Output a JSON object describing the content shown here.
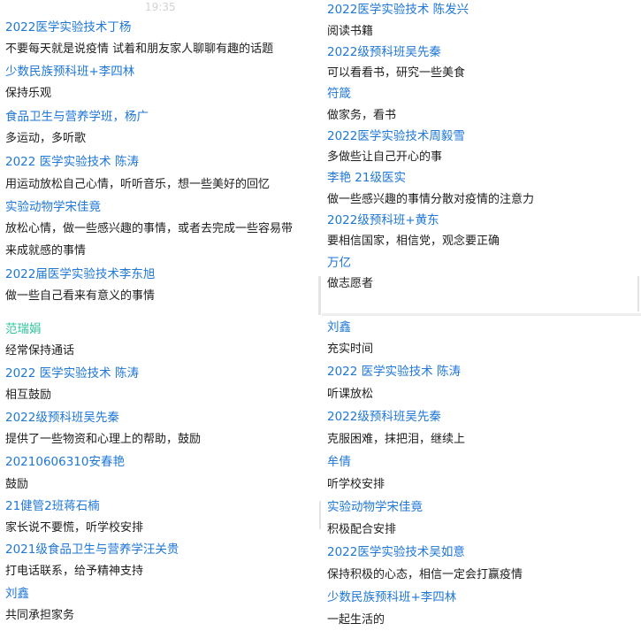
{
  "timestamp": "19:35",
  "panels": [
    {
      "id": "tl",
      "messages": [
        {
          "name": "2022医学实验技术丁杨",
          "text": "不要每天就是说疫情 试着和朋友家人聊聊有趣的话题"
        },
        {
          "name": "少数民族预科班+李四林",
          "text": "保持乐观"
        },
        {
          "name": "食品卫生与营养学班，杨广",
          "text": "多运动，多听歌"
        },
        {
          "name": "2022 医学实验技术  陈涛",
          "text": "用运动放松自己心情，听听音乐，想一些美好的回忆"
        },
        {
          "name": "实验动物学宋佳竟",
          "text": "放松心情，做一些感兴趣的事情，或者去完成一些容易带",
          "text2": "来成就感的事情"
        },
        {
          "name": "2022届医学实验技术李东旭",
          "text": "做一些自己看来有意义的事情"
        }
      ]
    },
    {
      "id": "tr",
      "messages": [
        {
          "name": "2022医学实验技术 陈发兴",
          "text": "阅读书籍"
        },
        {
          "name": "2022级预科班吴先秦",
          "text": "可以看看书，研究一些美食"
        },
        {
          "name": "符箴",
          "text": "做家务，看书"
        },
        {
          "name": "2022医学实验技术周毅雪",
          "text": "多做些让自己开心的事"
        },
        {
          "name": "李艳  21级医实",
          "text": "做一些感兴趣的事情分散对疫情的注意力"
        },
        {
          "name": "2022级预科班+黄东",
          "text": "要相信国家，相信党，观念要正确"
        },
        {
          "name": "万亿",
          "text": "做志愿者"
        }
      ]
    },
    {
      "id": "bl",
      "messages": [
        {
          "name": "范瑞娟",
          "name_color": "green",
          "text": "经常保持通话"
        },
        {
          "name": "2022 医学实验技术  陈涛",
          "text": "相互鼓励"
        },
        {
          "name": "2022级预科班吴先秦",
          "text": "提供了一些物资和心理上的帮助，鼓励"
        },
        {
          "name": "20210606310安春艳",
          "text": "鼓励"
        },
        {
          "name": "21健管2班蒋石楠",
          "text": "家长说不要慌，听学校安排"
        },
        {
          "name": "2021级食品卫生与营养学汪关贵",
          "text": "打电话联系，给予精神支持"
        },
        {
          "name": "刘鑫",
          "text": "共同承担家务"
        }
      ]
    },
    {
      "id": "br",
      "messages": [
        {
          "name": "刘鑫",
          "text": "充实时间"
        },
        {
          "name": "2022 医学实验技术  陈涛",
          "text": "听课放松"
        },
        {
          "name": "2022级预科班吴先秦",
          "text": "克服困难，抹把泪，继续上"
        },
        {
          "name": "牟倩",
          "text": "听学校安排"
        },
        {
          "name": "实验动物学宋佳竟",
          "text": "积极配合安排"
        },
        {
          "name": "2022医学实验技术吴如意",
          "text": "保持积极的心态，相信一定会打赢疫情"
        },
        {
          "name": "少数民族预科班+李四林",
          "text": "一起生活的"
        }
      ]
    }
  ]
}
